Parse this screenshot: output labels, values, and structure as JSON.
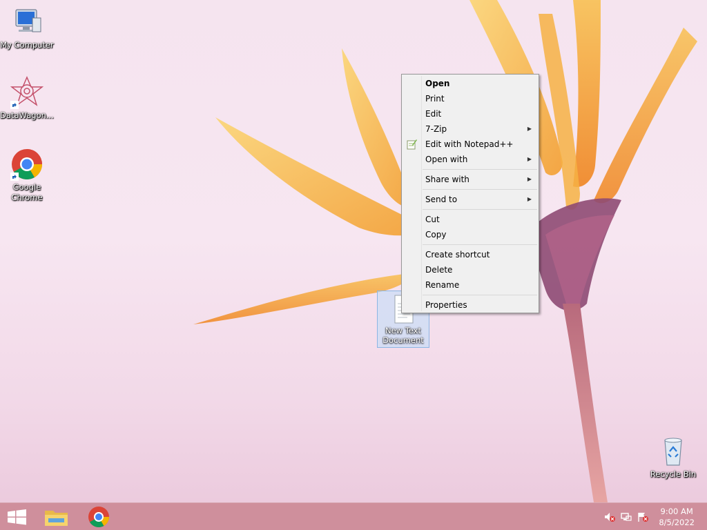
{
  "desktop_icons": [
    {
      "label": "My Computer"
    },
    {
      "label": "DataWagon..."
    },
    {
      "label": "Google Chrome"
    },
    {
      "label": "Recycle Bin"
    }
  ],
  "selected_file": {
    "label": "New Text Document"
  },
  "context_menu": {
    "items": [
      {
        "label": "Open",
        "bold": true
      },
      {
        "label": "Print"
      },
      {
        "label": "Edit"
      },
      {
        "label": "7-Zip",
        "submenu": true
      },
      {
        "label": "Edit with Notepad++",
        "icon": "notepad-plus-icon"
      },
      {
        "label": "Open with",
        "submenu": true
      },
      {
        "label": "Share with",
        "submenu": true
      },
      {
        "label": "Send to",
        "submenu": true
      },
      {
        "label": "Cut"
      },
      {
        "label": "Copy"
      },
      {
        "label": "Create shortcut"
      },
      {
        "label": "Delete"
      },
      {
        "label": "Rename"
      },
      {
        "label": "Properties"
      }
    ],
    "submenu_arrow": "▶"
  },
  "taskbar": {
    "clock_time": "9:00 AM",
    "clock_date": "8/5/2022",
    "pinned": [
      "start-button",
      "file-explorer-icon",
      "chrome-icon"
    ],
    "tray": [
      "volume-muted-icon",
      "network-icon",
      "action-center-icon"
    ]
  },
  "colors": {
    "menu_bg": "#f0f0f0",
    "taskbar": "#cf8f9c",
    "selection": "#bedcfa"
  }
}
